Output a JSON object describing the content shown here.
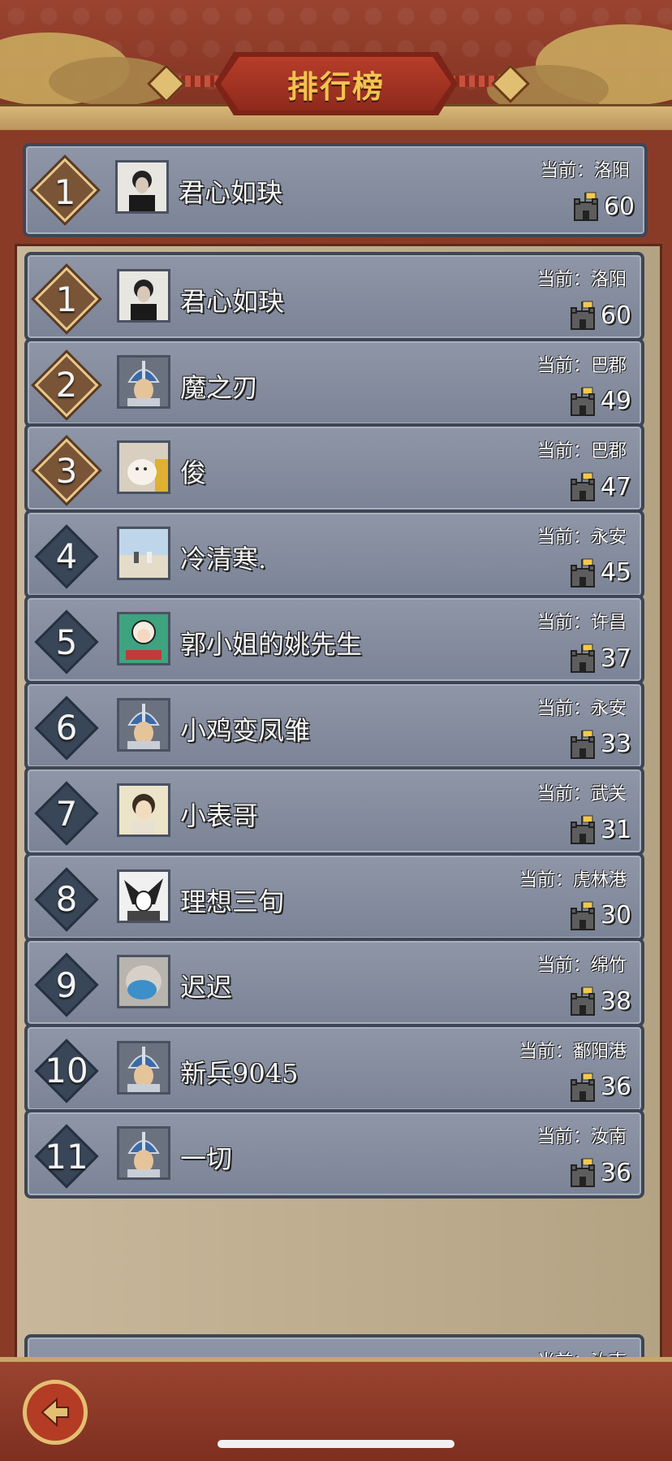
{
  "header": {
    "title": "排行榜"
  },
  "my_rank": {
    "rank": "1",
    "name": "君心如玦",
    "location": "当前：洛阳",
    "count": "60",
    "tier": "gold",
    "avatar": "avatar-man-black-hair"
  },
  "rankings": [
    {
      "rank": "1",
      "name": "君心如玦",
      "location": "当前：洛阳",
      "count": "60",
      "tier": "gold",
      "avatar": "avatar-man-black-hair"
    },
    {
      "rank": "2",
      "name": "魔之刃",
      "location": "当前：巴郡",
      "count": "49",
      "tier": "gold",
      "avatar": "avatar-helmet-soldier"
    },
    {
      "rank": "3",
      "name": "俊",
      "location": "当前：巴郡",
      "count": "47",
      "tier": "gold",
      "avatar": "avatar-white-cat"
    },
    {
      "rank": "4",
      "name": "冷清寒.",
      "location": "当前：永安",
      "count": "45",
      "tier": "dark",
      "avatar": "avatar-beach-couple"
    },
    {
      "rank": "5",
      "name": "郭小姐的姚先生",
      "location": "当前：许昌",
      "count": "37",
      "tier": "dark",
      "avatar": "avatar-cartoon-girl"
    },
    {
      "rank": "6",
      "name": "小鸡变凤雏",
      "location": "当前：永安",
      "count": "33",
      "tier": "dark",
      "avatar": "avatar-helmet-soldier"
    },
    {
      "rank": "7",
      "name": "小表哥",
      "location": "当前：武关",
      "count": "31",
      "tier": "dark",
      "avatar": "avatar-anime-boy"
    },
    {
      "rank": "8",
      "name": "理想三旬",
      "location": "当前：虎林港",
      "count": "30",
      "tier": "dark",
      "avatar": "avatar-manga-character"
    },
    {
      "rank": "9",
      "name": "迟迟",
      "location": "当前：绵竹",
      "count": "38",
      "tier": "dark",
      "avatar": "avatar-masked-cat"
    },
    {
      "rank": "10",
      "name": "新兵9045",
      "location": "当前：鄱阳港",
      "count": "36",
      "tier": "dark",
      "avatar": "avatar-helmet-soldier"
    },
    {
      "rank": "11",
      "name": "一切",
      "location": "当前：汝南",
      "count": "36",
      "tier": "dark",
      "avatar": "avatar-helmet-soldier"
    }
  ],
  "partial_row": {
    "location": "当前：汝南"
  },
  "footer": {
    "back_icon": "back-arrow-icon"
  },
  "colors": {
    "row_bg": "#8e96a7",
    "gold_badge": "#7a5436",
    "dark_badge": "#384657",
    "flag": "#f2c94c"
  }
}
